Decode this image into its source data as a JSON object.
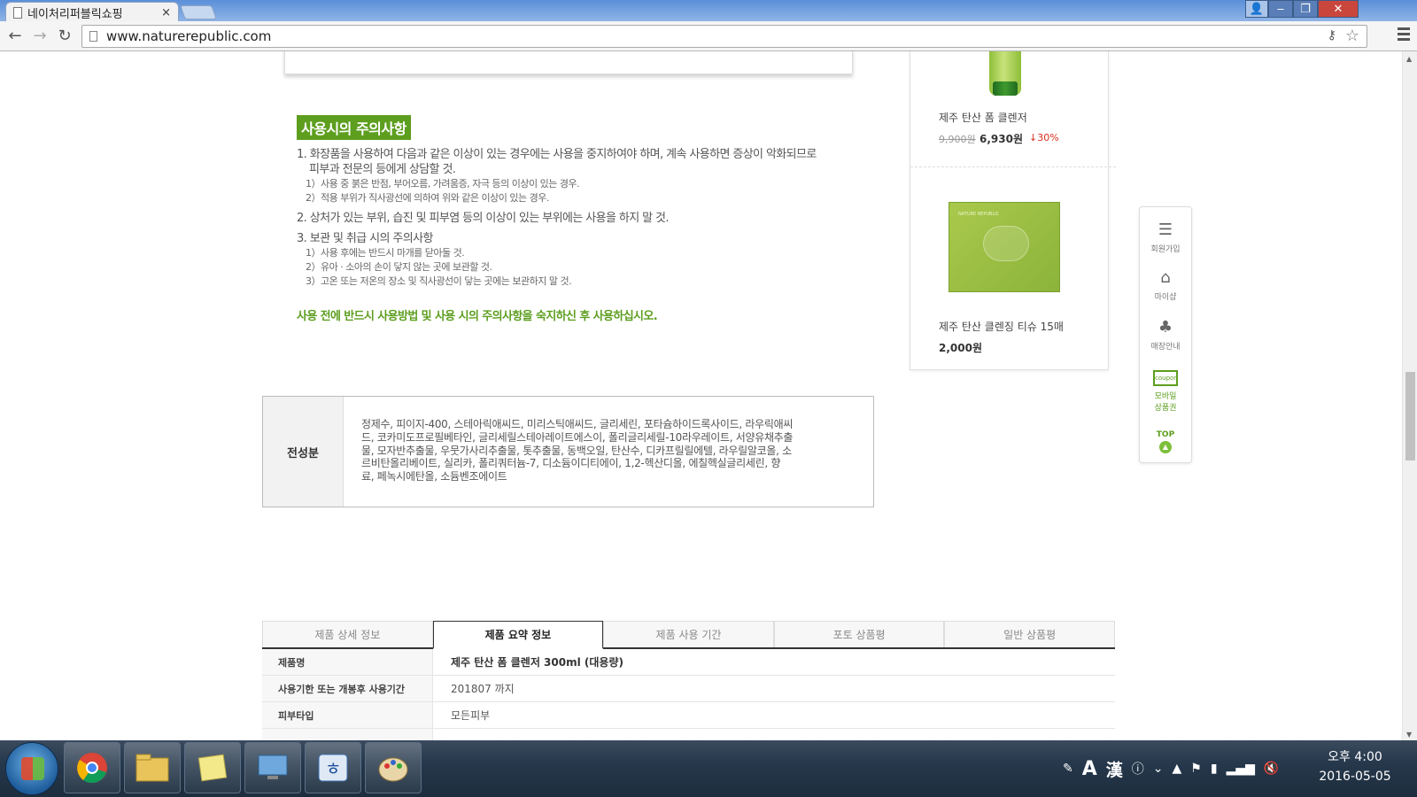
{
  "browser": {
    "tab_title": "네이처리퍼블릭쇼핑",
    "tab_close": "×",
    "url": "www.naturerepublic.com"
  },
  "caution": {
    "title": "사용시의 주의사항",
    "items": [
      "1. 화장품을 사용하여 다음과 같은 이상이 있는 경우에는 사용을 중지하여야 하며, 계속 사용하면 증상이 악화되므로",
      "피부과 전문의 등에게 상담할 것.",
      "1）사용 중 붉은 반점, 부어오름, 가려움증, 자극 등의 이상이 있는 경우.",
      "2）적용 부위가 직사광선에 의하여 위와 같은 이상이 있는 경우.",
      "2. 상처가 있는 부위, 습진 및 피부염 등의 이상이 있는 부위에는 사용을 하지 말 것.",
      "3. 보관 및 취급 시의 주의사항",
      "1）사용 후에는 반드시 마개를 닫아둘 것.",
      "2）유아 · 소아의 손이 닿지 않는 곳에 보관할 것.",
      "3）고온 또는 저온의 장소 및 직사광선이 닿는 곳에는 보관하지 말 것."
    ],
    "notice": "사용 전에 반드시 사용방법 및 사용 시의 주의사항을 숙지하신 후 사용하십시오."
  },
  "ingredients": {
    "label": "전성분",
    "lines": [
      "정제수, 피이지-400, 스테아릭애씨드, 미리스틱애씨드, 글리세린, 포타슘하이드록사이드, 라우릭애씨",
      "드, 코카미도프로필베타인, 글리세릴스테아레이트에스이, 폴리글리세릴-10라우레이트, 서양유채추출",
      "물, 모자반추출물, 우뭇가사리추출물, 톳추출물, 동백오일, 탄산수, 디카프릴릴에텔, 라우릴알코올, 소",
      "르비탄올리베이트, 실리카, 폴리쿼터늄-7, 디소듐이디티에이, 1,2-헥산디올, 에칠헥실글리세린, 향",
      "료, 페녹시에탄올, 소듐벤조에이트"
    ]
  },
  "side_products": [
    {
      "name": "제주 탄산 폼 클렌저",
      "price_old": "9,900원",
      "price": "6,930원",
      "discount": "30%"
    },
    {
      "name": "제주 탄산 클렌징 티슈 15매",
      "price": "2,000원"
    }
  ],
  "tissue_brand": "NATURE REPUBLIC",
  "quick_menu": {
    "join": "회원가입",
    "myshop": "마이샵",
    "store": "매장안내",
    "coupon_icon": "coupon",
    "coupon_line1": "모바일",
    "coupon_line2": "상품권",
    "top": "TOP"
  },
  "summary": {
    "tabs": [
      "제품 상세 정보",
      "제품 요약 정보",
      "제품 사용 기간",
      "포토 상품평",
      "일반 상품평"
    ],
    "active_tab": 1,
    "rows": [
      {
        "key": "제품명",
        "value": "제주 탄산 폼 클렌저 300ml (대용량)"
      },
      {
        "key": "사용기한 또는 개봉후 사용기간",
        "value": "201807 까지"
      },
      {
        "key": "피부타입",
        "value": "모든피부"
      }
    ]
  },
  "taskbar": {
    "apps": [
      "chrome-icon",
      "file-explorer-icon",
      "sticky-notes-icon",
      "remote-desktop-icon",
      "hangul-icon",
      "paint-icon"
    ],
    "ime_a": "A",
    "ime_han": "漢",
    "time": "오후 4:00",
    "date": "2016-05-05"
  },
  "colors": {
    "accent_green": "#5d9e1f",
    "discount_red": "#d9301e"
  }
}
